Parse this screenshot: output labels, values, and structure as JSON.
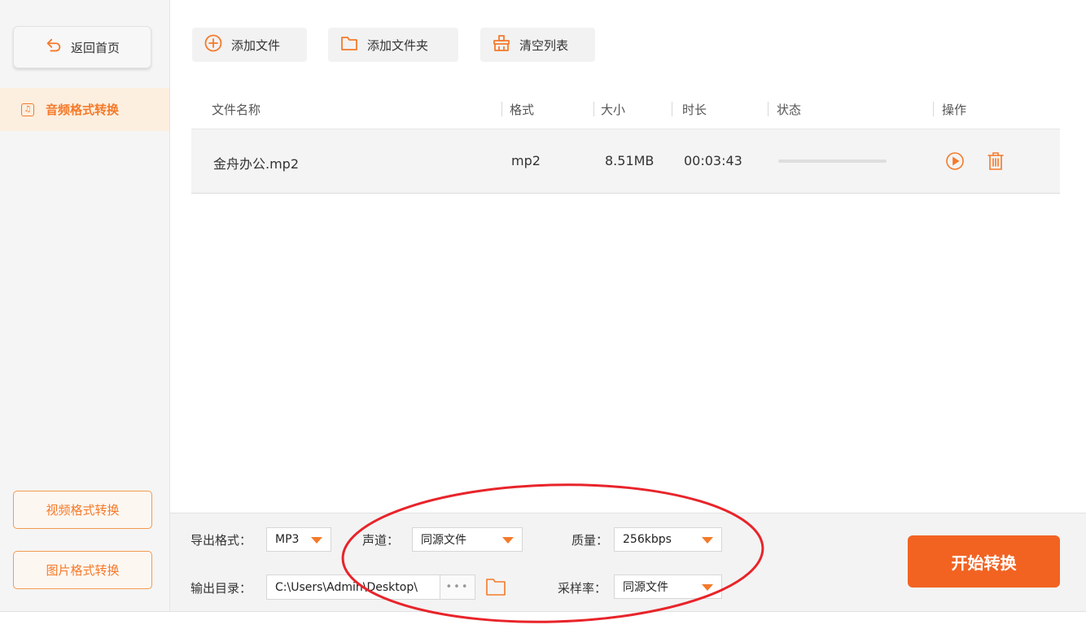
{
  "sidebar": {
    "back_label": "返回首页",
    "active_item": "音频格式转换",
    "video_button": "视频格式转换",
    "image_button": "图片格式转换"
  },
  "toolbar": {
    "add_file": "添加文件",
    "add_folder": "添加文件夹",
    "clear_list": "清空列表"
  },
  "table": {
    "headers": [
      "文件名称",
      "格式",
      "大小",
      "时长",
      "状态",
      "操作"
    ],
    "rows": [
      {
        "name": "金舟办公.mp2",
        "format": "mp2",
        "size": "8.51MB",
        "duration": "00:03:43",
        "progress": 0
      }
    ]
  },
  "settings": {
    "export_format_label": "导出格式：",
    "export_format_value": "MP3",
    "channel_label": "声道：",
    "channel_value": "同源文件",
    "quality_label": "质量：",
    "quality_value": "256kbps",
    "output_dir_label": "输出目录：",
    "output_dir_value": "C:\\Users\\Admin\\Desktop\\",
    "sample_rate_label": "采样率：",
    "sample_rate_value": "同源文件",
    "more_label": "•••"
  },
  "actions": {
    "start_label": "开始转换"
  },
  "colors": {
    "accent": "#f47a2a",
    "start_button": "#f26322",
    "annotation": "#e8242a"
  }
}
